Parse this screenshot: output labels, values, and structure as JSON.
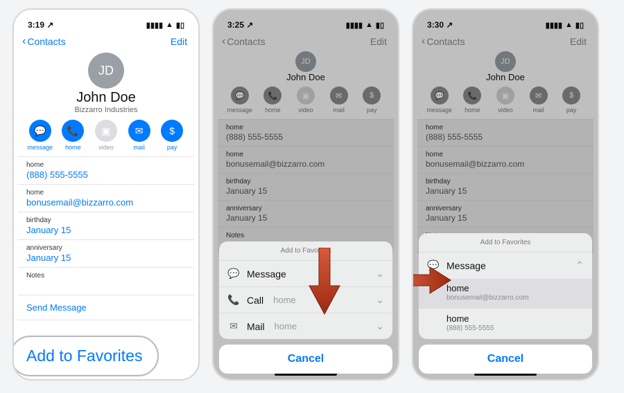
{
  "panel1": {
    "status_time": "3:19",
    "status_arrow": "↗",
    "nav_back": "Contacts",
    "nav_edit": "Edit",
    "initials": "JD",
    "name": "John  Doe",
    "org": "Bizzarro Industries",
    "actions": {
      "message": "message",
      "home": "home",
      "video": "video",
      "mail": "mail",
      "pay": "pay"
    },
    "f_phone_k": "home",
    "f_phone_v": "(888) 555-5555",
    "f_email_k": "home",
    "f_email_v": "bonusemail@bizzarro.com",
    "f_bday_k": "birthday",
    "f_bday_v": "January 15",
    "f_anniv_k": "anniversary",
    "f_anniv_v": "January 15",
    "f_notes_k": "Notes",
    "link_send_message": "Send Message",
    "callout": "Add to Favorites"
  },
  "panel2": {
    "status_time": "3:25",
    "nav_back": "Contacts",
    "nav_edit": "Edit",
    "initials": "JD",
    "name": "John  Doe",
    "f_phone_k": "home",
    "f_phone_v": "(888) 555-5555",
    "f_email_k": "home",
    "f_email_v": "bonusemail@bizzarro.com",
    "f_bday_k": "birthday",
    "f_bday_v": "January 15",
    "f_anniv_k": "anniversary",
    "f_anniv_v": "January 15",
    "f_notes_k": "Notes",
    "sheet_title": "Add to Favorites",
    "row_message": "Message",
    "row_call": "Call",
    "row_call_sub": "home",
    "row_mail": "Mail",
    "row_mail_sub": "home",
    "cancel": "Cancel",
    "actions": {
      "message": "message",
      "home": "home",
      "video": "video",
      "mail": "mail",
      "pay": "pay"
    }
  },
  "panel3": {
    "status_time": "3:30",
    "nav_back": "Contacts",
    "nav_edit": "Edit",
    "initials": "JD",
    "name": "John  Doe",
    "f_phone_k": "home",
    "f_phone_v": "(888) 555-5555",
    "f_email_k": "home",
    "f_email_v": "bonusemail@bizzarro.com",
    "f_bday_k": "birthday",
    "f_bday_v": "January 15",
    "f_anniv_k": "anniversary",
    "f_anniv_v": "January 15",
    "f_notes_k": "Notes",
    "sheet_title": "Add to Favorites",
    "row_message": "Message",
    "sub1_t": "home",
    "sub1_s": "bonusemail@bizzarro.com",
    "sub2_t": "home",
    "sub2_s": "(888) 555-5555",
    "cancel": "Cancel",
    "actions": {
      "message": "message",
      "home": "home",
      "video": "video",
      "mail": "mail",
      "pay": "pay"
    }
  }
}
